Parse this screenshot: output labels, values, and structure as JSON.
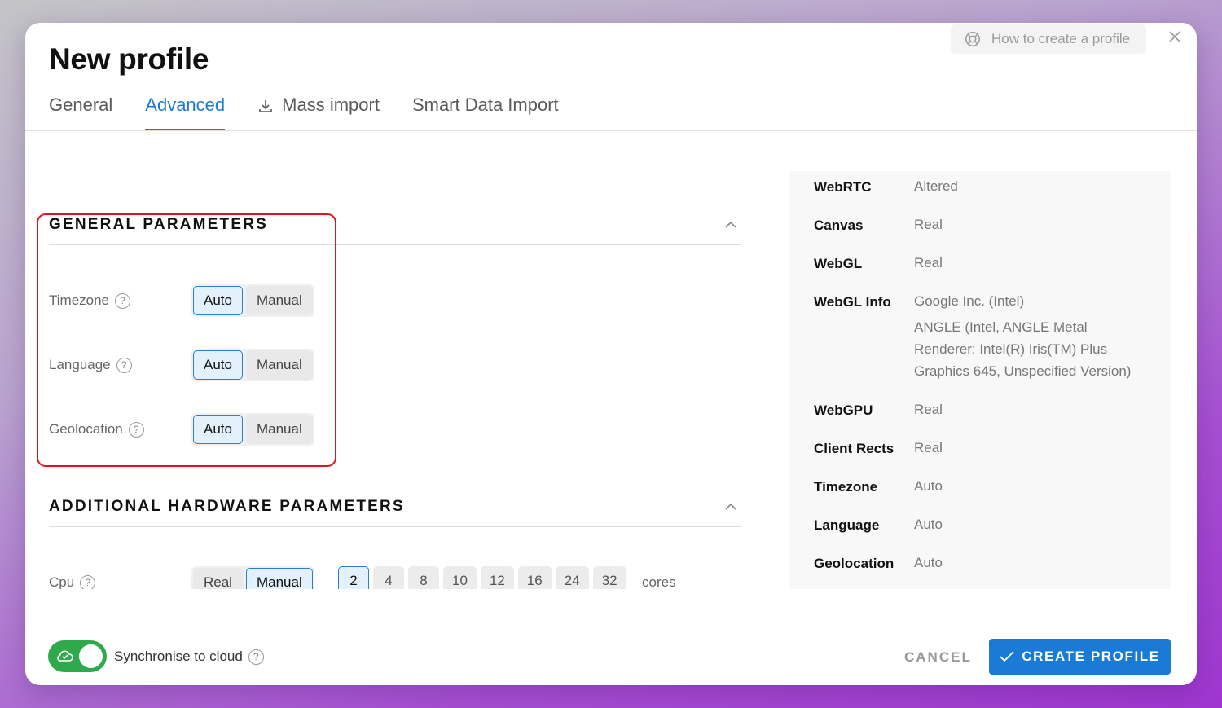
{
  "dialog": {
    "title": "New profile",
    "help_label": "How to create a profile",
    "help_icon": "lifebuoy-icon",
    "close_icon": "close-icon"
  },
  "tabs": [
    {
      "label": "General",
      "active": false
    },
    {
      "label": "Advanced",
      "active": true
    },
    {
      "label": "Mass import",
      "active": false,
      "icon": "download-icon"
    },
    {
      "label": "Smart Data Import",
      "active": false
    }
  ],
  "general": {
    "title": "GENERAL PARAMETERS",
    "rows": [
      {
        "label": "Timezone",
        "options": [
          "Auto",
          "Manual"
        ],
        "selected": "Auto"
      },
      {
        "label": "Language",
        "options": [
          "Auto",
          "Manual"
        ],
        "selected": "Auto"
      },
      {
        "label": "Geolocation",
        "options": [
          "Auto",
          "Manual"
        ],
        "selected": "Auto"
      }
    ]
  },
  "hardware": {
    "title": "ADDITIONAL HARDWARE PARAMETERS",
    "cpu": {
      "label": "Cpu",
      "options": [
        "Real",
        "Manual"
      ],
      "selected": "Manual",
      "cores": [
        "2",
        "4",
        "8",
        "10",
        "12",
        "16",
        "24",
        "32"
      ],
      "selected_core": "2",
      "unit": "cores"
    }
  },
  "summary": [
    {
      "key": "WebRTC",
      "value": "Altered"
    },
    {
      "key": "Canvas",
      "value": "Real"
    },
    {
      "key": "WebGL",
      "value": "Real"
    },
    {
      "key": "WebGL Info",
      "value": "Google Inc. (Intel)",
      "extra": "ANGLE (Intel, ANGLE Metal Renderer: Intel(R) Iris(TM) Plus Graphics 645, Unspecified Version)"
    },
    {
      "key": "WebGPU",
      "value": "Real"
    },
    {
      "key": "Client Rects",
      "value": "Real"
    },
    {
      "key": "Timezone",
      "value": "Auto"
    },
    {
      "key": "Language",
      "value": "Auto"
    },
    {
      "key": "Geolocation",
      "value": "Auto"
    }
  ],
  "footer": {
    "sync_label": "Synchronise to cloud",
    "sync_on": true,
    "cancel_label": "CANCEL",
    "create_label": "CREATE PROFILE"
  },
  "colors": {
    "accent": "#1a7bd6",
    "toggle_on": "#2eaa4c",
    "highlight": "#e0141e"
  }
}
